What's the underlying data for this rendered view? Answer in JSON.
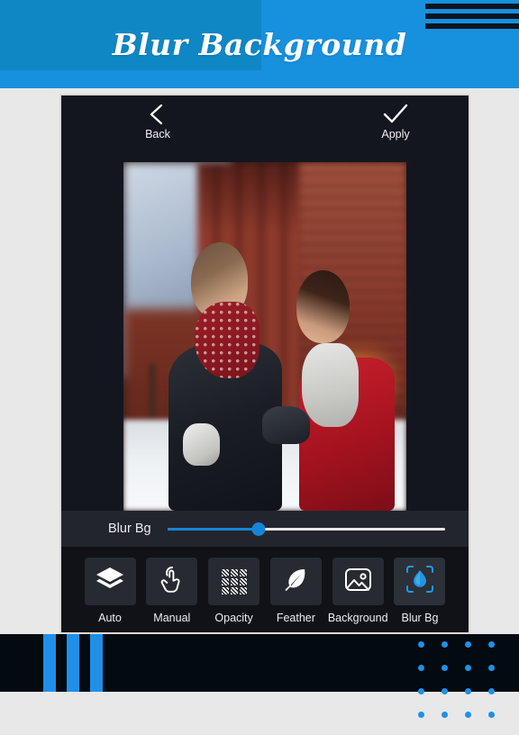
{
  "promo": {
    "title": "Blur Background",
    "header_bg": "#1790de",
    "header_block_bg": "#0f87c4",
    "line_color": "#0d1420",
    "accent": "#1e90e8",
    "band_bg": "#030a10",
    "decor_lines": 3,
    "decor_bars": 3,
    "dot_columns": 4,
    "dot_rows": 4
  },
  "app": {
    "frame_bg": "#14161f",
    "appbar": {
      "back": {
        "label": "Back",
        "icon": "chevron-left-icon"
      },
      "apply": {
        "label": "Apply",
        "icon": "check-icon"
      }
    },
    "canvas": {
      "image_alt": "Couple embracing on a snowy street with blurred brick buildings"
    },
    "slider": {
      "label": "Blur Bg",
      "value": 33,
      "min": 0,
      "max": 100,
      "fill_color": "#1585d8",
      "track_color": "#e6e6e6"
    },
    "tools": [
      {
        "label": "Auto",
        "icon": "layers-icon",
        "active": false
      },
      {
        "label": "Manual",
        "icon": "tap-hand-icon",
        "active": false
      },
      {
        "label": "Opacity",
        "icon": "checkerboard-icon",
        "active": false
      },
      {
        "label": "Feather",
        "icon": "feather-icon",
        "active": false
      },
      {
        "label": "Background",
        "icon": "image-icon",
        "active": false
      },
      {
        "label": "Blur Bg",
        "icon": "water-drop-icon",
        "active": true
      }
    ]
  }
}
